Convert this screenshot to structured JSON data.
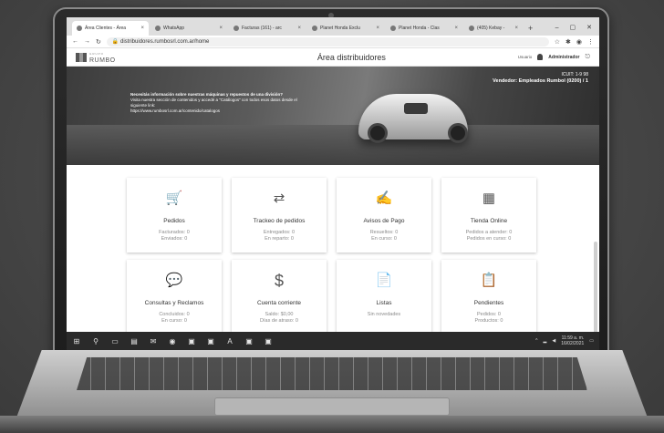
{
  "browser": {
    "tabs": [
      {
        "label": "Área Clientes - Área",
        "active": true
      },
      {
        "label": "WhatsApp",
        "active": false
      },
      {
        "label": "Facturas (161) - arc",
        "active": false
      },
      {
        "label": "Planet Honda Exclu",
        "active": false
      },
      {
        "label": "Planet Honda - Clas",
        "active": false
      },
      {
        "label": "(405) Kebay - ",
        "active": false
      }
    ],
    "new_tab": "+",
    "url": "distribuidores.rumbosrl.com.ar/home",
    "window_controls": {
      "minimize": "–",
      "maximize": "▢",
      "close": "✕"
    }
  },
  "header": {
    "brand_top": "GRUPO",
    "brand": "RUMBO",
    "title": "Área distribuidores",
    "user_label": "Usuario",
    "user_name": "Administrador"
  },
  "hero": {
    "message_title": "Necesitás información sobre nuestras máquinas y repuestos de una división?",
    "message_body": "Visita nuestra sección de contenidos y accedé a \"Catálogos\" con todos esos datos desde el siguiente link:",
    "message_link": "https://www.rumbosrl.com.ar/contenido/catalogos",
    "cuit": "ICUIT: 1-9 98",
    "vendor": "Vendedor: Empleados Rumbol (0200) / 1"
  },
  "cards": [
    {
      "icon": "cart-icon",
      "glyph": "🛒",
      "title": "Pedidos",
      "line1": "Facturados: 0",
      "line2": "Enviados: 0"
    },
    {
      "icon": "route-icon",
      "glyph": "⇄",
      "title": "Trackeo de pedidos",
      "line1": "Entregados: 0",
      "line2": "En reparto: 0"
    },
    {
      "icon": "payment-icon",
      "glyph": "✍",
      "title": "Avisos de Pago",
      "line1": "Resueltos: 0",
      "line2": "En curso: 0"
    },
    {
      "icon": "store-icon",
      "glyph": "▦",
      "title": "Tienda Online",
      "line1": "Pedidos a atender: 0",
      "line2": "Pedidos en curso: 0"
    },
    {
      "icon": "chat-icon",
      "glyph": "💬",
      "title": "Consultas y Reclamos",
      "line1": "Concluidos: 0",
      "line2": "En curso: 0"
    },
    {
      "icon": "dollar-icon",
      "glyph": "$",
      "title": "Cuenta corriente",
      "line1": "Saldo: $0,00",
      "line2": "Días de atraso: 0"
    },
    {
      "icon": "list-icon",
      "glyph": "📄",
      "title": "Listas",
      "line1": "Sin novedades",
      "line2": ""
    },
    {
      "icon": "pending-icon",
      "glyph": "📋",
      "title": "Pendientes",
      "line1": "Pedidos: 0",
      "line2": "Productos: 0"
    }
  ],
  "taskbar": {
    "time": "11:59 a. m.",
    "date": "16/02/2021"
  }
}
